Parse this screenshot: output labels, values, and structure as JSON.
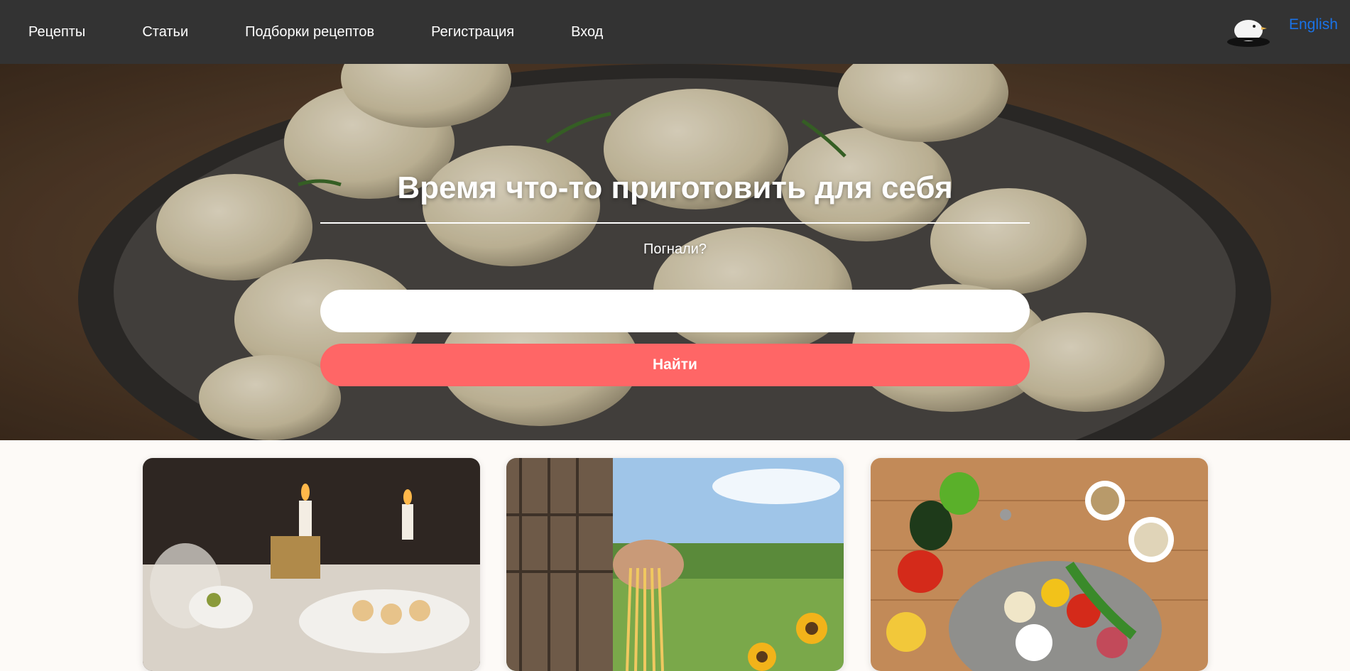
{
  "nav": {
    "items": [
      {
        "label": "Рецепты"
      },
      {
        "label": "Статьи"
      },
      {
        "label": "Подборки рецептов"
      },
      {
        "label": "Регистрация"
      },
      {
        "label": "Вход"
      }
    ],
    "language_label": "English",
    "logo_icon": "bird-logo-icon"
  },
  "hero": {
    "title": "Время что-то приготовить для себя",
    "subtitle": "Погнали?",
    "search": {
      "value": "",
      "placeholder": ""
    },
    "search_button_label": "Найти",
    "background": "dumplings-photo"
  },
  "colors": {
    "navbar": "#333333",
    "accent_button": "#ff6666",
    "language_link": "#1a73e8",
    "page_background": "#fdfaf7"
  },
  "cards": [
    {
      "image": "festive-table-candles-photo"
    },
    {
      "image": "fresh-pasta-sunflower-field-photo"
    },
    {
      "image": "vegetables-spices-platter-photo"
    }
  ]
}
